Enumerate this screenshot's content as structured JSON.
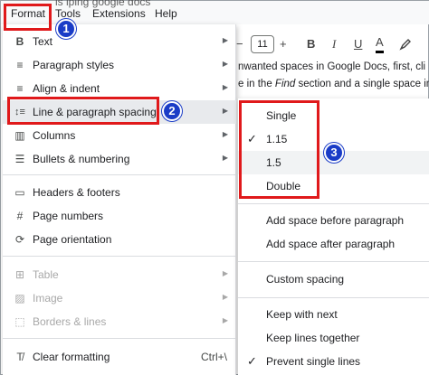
{
  "menubar": {
    "partial_title": "ls lplng google docs",
    "format": "Format",
    "tools": "Tools",
    "extensions": "Extensions",
    "help": "Help"
  },
  "toolbar": {
    "minus": "−",
    "font_size": "11",
    "plus": "+",
    "bold": "B",
    "italic": "I",
    "underline": "U",
    "text_color": "A"
  },
  "doc": {
    "line1": "nwanted spaces in Google Docs, first, cli",
    "line2_a": "e in the ",
    "line2_italic": "Find",
    "line2_b": " section and a single space in"
  },
  "format_menu": {
    "items": [
      {
        "label": "Text",
        "icon": "B"
      },
      {
        "label": "Paragraph styles",
        "icon": "≡"
      },
      {
        "label": "Align & indent",
        "icon": "≡"
      },
      {
        "label": "Line & paragraph spacing",
        "icon": "↕≡"
      },
      {
        "label": "Columns",
        "icon": "▥"
      },
      {
        "label": "Bullets & numbering",
        "icon": "☰"
      },
      {
        "label": "Headers & footers",
        "icon": "▭"
      },
      {
        "label": "Page numbers",
        "icon": "#"
      },
      {
        "label": "Page orientation",
        "icon": "⟳"
      },
      {
        "label": "Table",
        "icon": "⊞"
      },
      {
        "label": "Image",
        "icon": "▨"
      },
      {
        "label": "Borders & lines",
        "icon": "⬚"
      },
      {
        "label": "Clear formatting",
        "icon": "T̸",
        "shortcut": "Ctrl+\\"
      }
    ]
  },
  "spacing_submenu": {
    "items": [
      {
        "label": "Single",
        "checked": false
      },
      {
        "label": "1.15",
        "checked": true
      },
      {
        "label": "1.5",
        "checked": false
      },
      {
        "label": "Double",
        "checked": false
      },
      {
        "label": "Add space before paragraph",
        "checked": false
      },
      {
        "label": "Add space after paragraph",
        "checked": false
      },
      {
        "label": "Custom spacing",
        "checked": false
      },
      {
        "label": "Keep with next",
        "checked": false
      },
      {
        "label": "Keep lines together",
        "checked": false
      },
      {
        "label": "Prevent single lines",
        "checked": true
      }
    ]
  },
  "badges": [
    "1",
    "2",
    "3"
  ],
  "icons": {
    "arrow": "▶",
    "check": "✓"
  },
  "colors": {
    "callout_red": "#e0191b",
    "badge_blue": "#1a3cc7",
    "highlight": "#e8eaed"
  }
}
